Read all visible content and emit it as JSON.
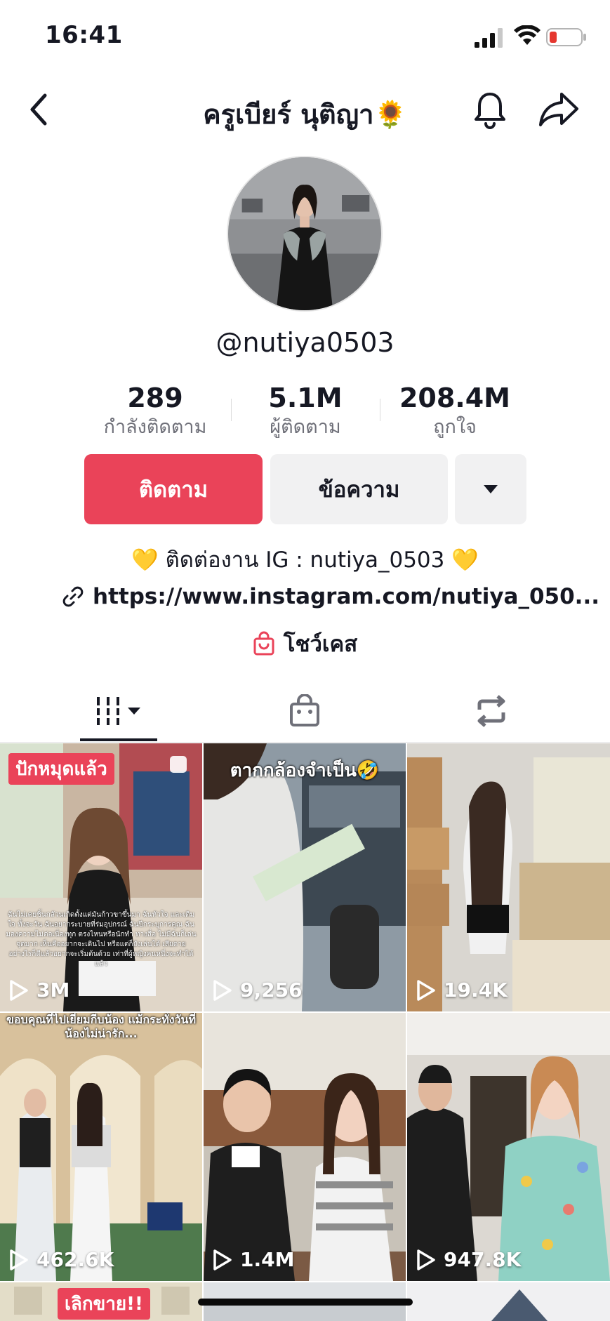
{
  "status_bar": {
    "time": "16:41",
    "icons": [
      "signal-icon",
      "wifi-icon",
      "battery-low-icon"
    ]
  },
  "nav": {
    "title": "ครูเบียร์ นุติญา🌻",
    "icons": [
      "back-chevron-icon",
      "bell-icon",
      "share-arrow-icon"
    ]
  },
  "profile": {
    "username": "@nutiya0503",
    "stats": [
      {
        "value": "289",
        "label": "กำลังติดตาม"
      },
      {
        "value": "5.1M",
        "label": "ผู้ติดตาม"
      },
      {
        "value": "208.4M",
        "label": "ถูกใจ"
      }
    ],
    "buttons": {
      "follow": "ติดตาม",
      "message": "ข้อความ"
    },
    "bio": "💛 ติดต่องาน IG : nutiya_0503 💛",
    "link": "https://www.instagram.com/nutiya_050...",
    "showcase": "โชว์เคส"
  },
  "tabs": {
    "icons": [
      "videos-grid-icon",
      "shop-bag-icon",
      "repost-icon"
    ],
    "selected": "videos"
  },
  "videos": [
    {
      "views": "3M",
      "pinned_label": "ปักหมุดแล้ว",
      "overlay": "",
      "caption": "ฉันไม่เคยชิ้นกลัวนเกิดตั้งแต่มันก้าวขาขึ้นมา ฉันหัวใจ และเติมใจ ทั้งจะวัน ฉันอยากระบายที่ร่มอุปกรณ์ ฉันปีกระบุการคุณ ฉันมองความไม่ต่อเนื่องทุก ตรงไหนหรือนักทำ ทางสื่อ ไม่มีฉันก็เล่นจุดมาก เห็นคืออยากจะเดินไป หรือแต่ก็ยังเล่นได้ เสียดายอย่างไรก็ดีแล้วอยากจะเริ่มต้นด้วย เท่าที่ผู้หญิงคนหนึ่งจะทำได้แล้ว"
    },
    {
      "views": "9,256",
      "pinned_label": "",
      "overlay": "ตากกล้องจำเป็น🤣",
      "caption": ""
    },
    {
      "views": "19.4K",
      "pinned_label": "",
      "overlay": "",
      "caption": ""
    },
    {
      "views": "462.6K",
      "pinned_label": "",
      "overlay": "ขอบคุณที่ไปเยี่ยมกีบน้อง แม้กระทั่งวันที่น้องไม่น่ารัก...",
      "caption": ""
    },
    {
      "views": "1.4M",
      "pinned_label": "",
      "overlay": "",
      "caption": ""
    },
    {
      "views": "947.8K",
      "pinned_label": "",
      "overlay": "",
      "caption": ""
    },
    {
      "views": "",
      "pinned_label": "เลิกขาย!!",
      "overlay": "",
      "caption": ""
    }
  ],
  "colors": {
    "accent": "#ea4359",
    "text": "#161823",
    "muted": "#6f7079",
    "button_gray": "#f1f1f2"
  }
}
